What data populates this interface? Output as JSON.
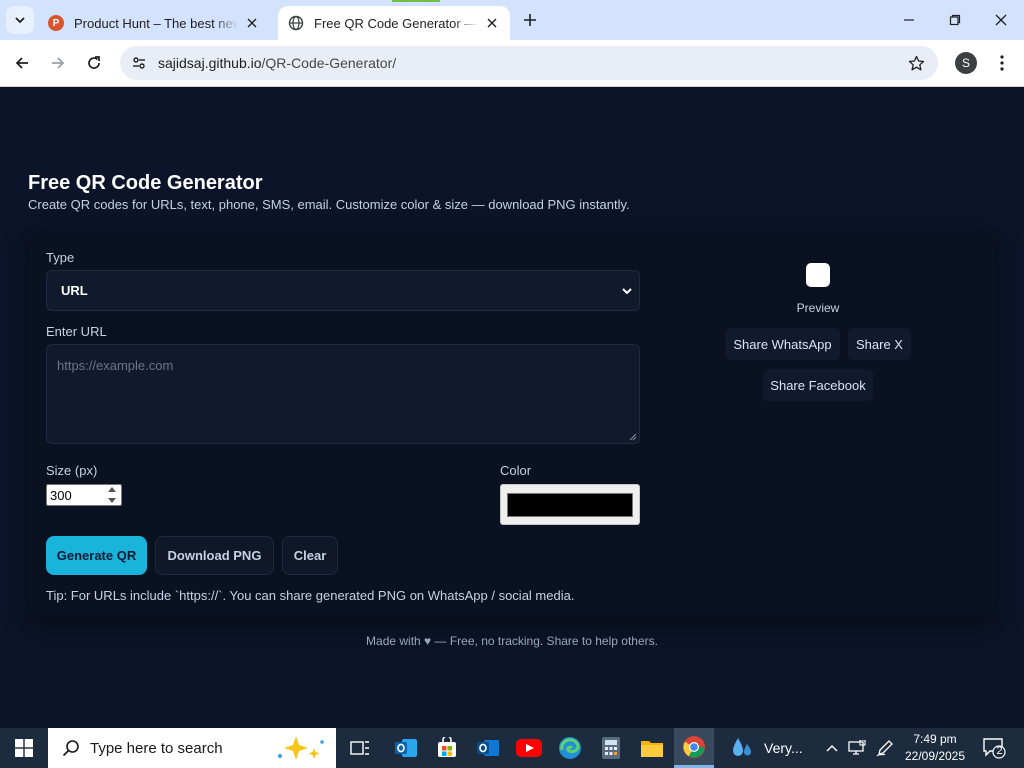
{
  "browser": {
    "tabs": [
      {
        "title": "Product Hunt – The best new products in tech",
        "favicon": "P",
        "active": false
      },
      {
        "title": "Free QR Code Generator — Create QR codes",
        "favicon": "globe",
        "active": true
      }
    ],
    "address": {
      "host": "sajidsaj.github.io",
      "path": "/QR-Code-Generator/"
    },
    "profile_initial": "S"
  },
  "page": {
    "title": "Free QR Code Generator",
    "subtitle": "Create QR codes for URLs, text, phone, SMS, email. Customize color & size — download PNG instantly.",
    "form": {
      "type_label": "Type",
      "type_value": "URL",
      "url_label": "Enter URL",
      "url_placeholder": "https://example.com",
      "url_value": "",
      "size_label": "Size (px)",
      "size_value": "300",
      "color_label": "Color",
      "color_value": "#000000"
    },
    "buttons": {
      "generate": "Generate QR",
      "download": "Download PNG",
      "clear": "Clear"
    },
    "tip": "Tip: For URLs include `https://`. You can share generated PNG on WhatsApp / social media.",
    "preview": {
      "label": "Preview",
      "share_whatsapp": "Share WhatsApp",
      "share_x": "Share X",
      "share_facebook": "Share Facebook"
    },
    "footer": "Made with ♥ — Free, no tracking. Share to help others."
  },
  "taskbar": {
    "search_placeholder": "Type here to search",
    "weather": "Very...",
    "time": "7:49 pm",
    "date": "22/09/2025",
    "notifications": "2"
  },
  "colors": {
    "page_bg": "#0b1428",
    "card_bg": "#0a1222",
    "accent": "#1ab3d9",
    "chrome_tabbar": "#d3e3fd"
  }
}
